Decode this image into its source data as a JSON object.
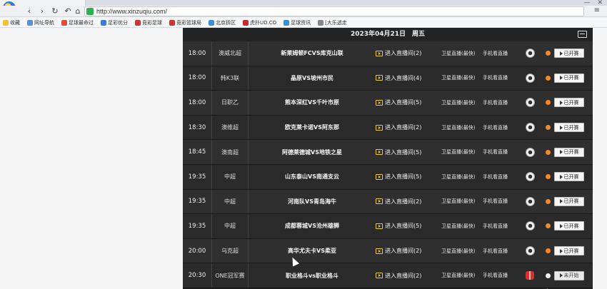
{
  "browser": {
    "url": "http://www.xinzuqiu.com/",
    "win_min": "—",
    "win_close": "✕",
    "bookmarks": [
      "收藏",
      "网址导航",
      "足球最命过",
      "足彩优分",
      "竞彩足球",
      "竞彩篮球局",
      "北京拆区",
      "虎扑UD.CO",
      "足球资讯",
      "[大乐透走"
    ]
  },
  "schedule": {
    "date_header": "2023年04月21日　周五",
    "rows": [
      {
        "time": "18:00",
        "league": "澳威北超",
        "match": "新莱姆顿FCVS库克山联",
        "live": "进入直播间(2)",
        "sat": "卫星直播(最快)",
        "mobile": "手机看直播",
        "icon": "ball",
        "status": "已开赛"
      },
      {
        "time": "18:00",
        "league": "韩K3联",
        "match": "晶原VS坡州市民",
        "live": "进入直播间(4)",
        "sat": "卫星直播(最快)",
        "mobile": "手机看直播",
        "icon": "ball",
        "status": "已开赛"
      },
      {
        "time": "18:00",
        "league": "日职乙",
        "match": "熊本深红VS千叶市原",
        "live": "进入直播间(5)",
        "sat": "卫星直播(最快)",
        "mobile": "手机看直播",
        "icon": "ball",
        "status": "已开赛"
      },
      {
        "time": "18:30",
        "league": "澳维超",
        "match": "欧克莱卡诺VS阿东那",
        "live": "进入直播间(2)",
        "sat": "卫星直播(最快)",
        "mobile": "手机看直播",
        "icon": "ball",
        "status": "已开赛"
      },
      {
        "time": "18:45",
        "league": "澳南超",
        "match": "阿德莱德城VS地铁之星",
        "live": "进入直播间(5)",
        "sat": "卫星直播(最快)",
        "mobile": "手机看直播",
        "icon": "ball",
        "status": "已开赛"
      },
      {
        "time": "19:35",
        "league": "中超",
        "match": "山东泰山VS南通支云",
        "live": "进入直播间(5)",
        "sat": "卫星直播(最快)",
        "mobile": "手机看直播",
        "icon": "ball",
        "status": "已开赛"
      },
      {
        "time": "19:35",
        "league": "中超",
        "match": "河南队VS青岛海牛",
        "live": "进入直播间(2)",
        "sat": "卫星直播(最快)",
        "mobile": "手机看直播",
        "icon": "ball",
        "status": "已开赛"
      },
      {
        "time": "19:35",
        "league": "中超",
        "match": "成都蓉城VS沧州雄狮",
        "live": "进入直播间(5)",
        "sat": "卫星直播(最快)",
        "mobile": "手机看直播",
        "icon": "ball",
        "status": "已开赛"
      },
      {
        "time": "20:00",
        "league": "乌克超",
        "match": "高华尤夫卡VS柔亚",
        "live": "进入直播间(2)",
        "sat": "卫星直播(最快)",
        "mobile": "手机看直播",
        "icon": "ball",
        "status": "已开赛"
      },
      {
        "time": "20:30",
        "league": "ONE冠军赛",
        "match": "职业格斗vs职业格斗",
        "live": "进入直播间(2)",
        "sat": "卫星直播(最快)",
        "mobile": "手机看直播",
        "icon": "gift",
        "status": "未开始"
      }
    ]
  },
  "colors": {
    "accent_dot": "#f08a2a",
    "panel": "#1f1f1f",
    "tv_icon": "#e8c93a"
  }
}
